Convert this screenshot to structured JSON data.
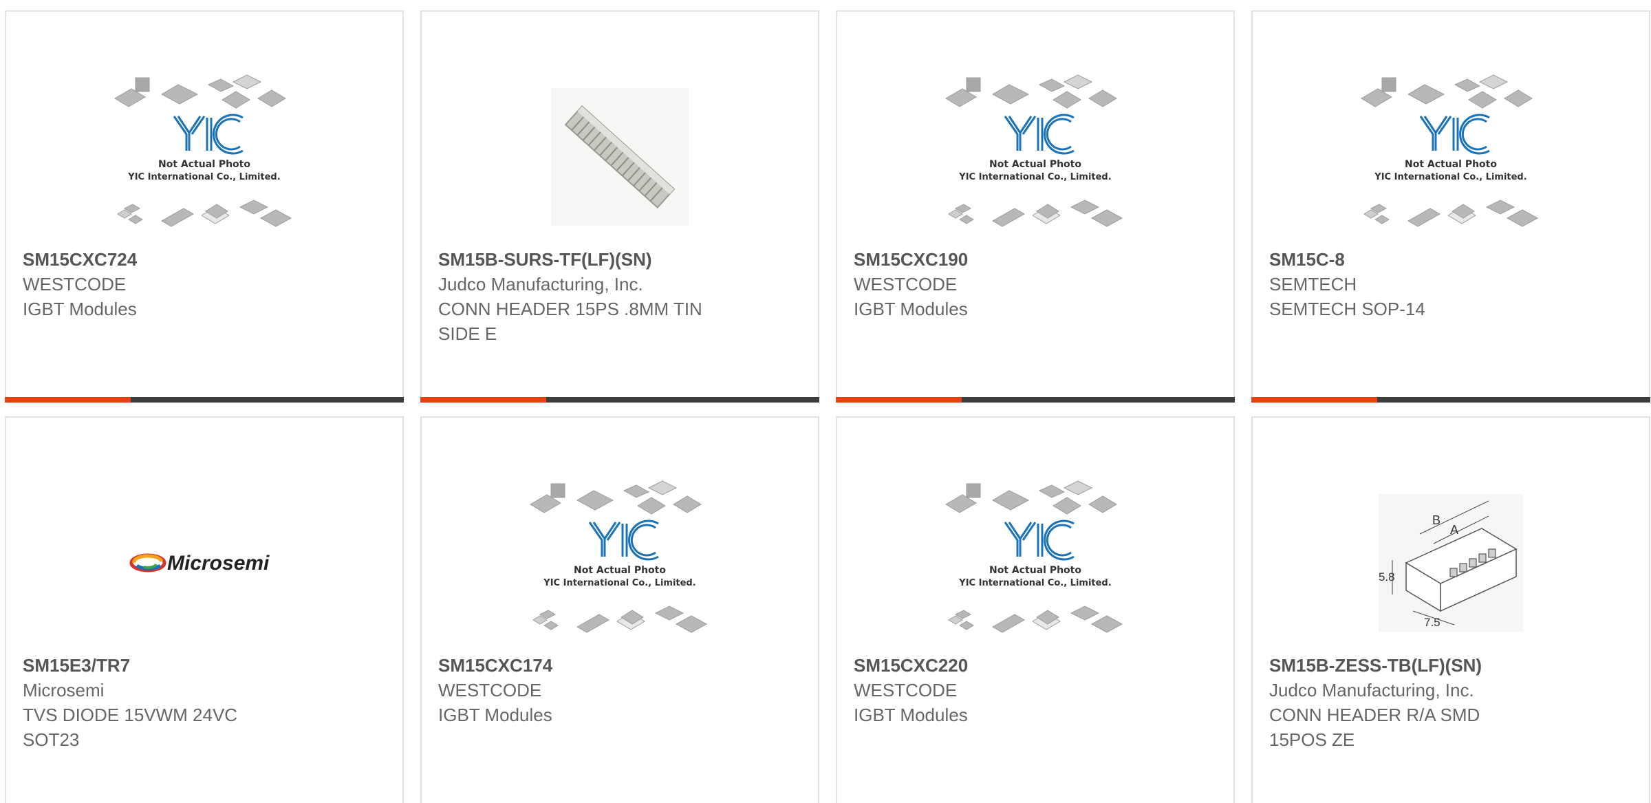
{
  "products": [
    {
      "part_number": "SM15CXC724",
      "manufacturer": "WESTCODE",
      "description": "IGBT Modules",
      "description_line2": "",
      "image": "placeholder",
      "placeholder_text_1": "Not Actual Photo",
      "placeholder_text_2": "YIC International Co., Limited.",
      "placeholder_logo": "YIC"
    },
    {
      "part_number": "SM15B-SURS-TF(LF)(SN)",
      "manufacturer": "Judco Manufacturing, Inc.",
      "description": "CONN HEADER 15PS .8MM TIN",
      "description_line2": "SIDE E",
      "image": "connector-strip"
    },
    {
      "part_number": "SM15CXC190",
      "manufacturer": "WESTCODE",
      "description": "IGBT Modules",
      "description_line2": "",
      "image": "placeholder",
      "placeholder_text_1": "Not Actual Photo",
      "placeholder_text_2": "YIC International Co., Limited.",
      "placeholder_logo": "YIC"
    },
    {
      "part_number": "SM15C-8",
      "manufacturer": "SEMTECH",
      "description": "SEMTECH SOP-14",
      "description_line2": "",
      "image": "placeholder",
      "placeholder_text_1": "Not Actual Photo",
      "placeholder_text_2": "YIC International Co., Limited.",
      "placeholder_logo": "YIC"
    },
    {
      "part_number": "SM15E3/TR7",
      "manufacturer": "Microsemi",
      "description": "TVS DIODE 15VWM 24VC",
      "description_line2": "SOT23",
      "image": "microsemi-logo",
      "logo_text": "Microsemi"
    },
    {
      "part_number": "SM15CXC174",
      "manufacturer": "WESTCODE",
      "description": "IGBT Modules",
      "description_line2": "",
      "image": "placeholder",
      "placeholder_text_1": "Not Actual Photo",
      "placeholder_text_2": "YIC International Co., Limited.",
      "placeholder_logo": "YIC"
    },
    {
      "part_number": "SM15CXC220",
      "manufacturer": "WESTCODE",
      "description": "IGBT Modules",
      "description_line2": "",
      "image": "placeholder",
      "placeholder_text_1": "Not Actual Photo",
      "placeholder_text_2": "YIC International Co., Limited.",
      "placeholder_logo": "YIC"
    },
    {
      "part_number": "SM15B-ZESS-TB(LF)(SN)",
      "manufacturer": "Judco Manufacturing, Inc.",
      "description": "CONN HEADER R/A SMD",
      "description_line2": "15POS ZE",
      "image": "connector-drawing",
      "drawing_labels": [
        "B",
        "A",
        "5.8",
        "7.5"
      ]
    }
  ],
  "colors": {
    "accent": "#e8410f",
    "bar": "#3d3d3d",
    "border": "#e3e3e3",
    "text": "#666666",
    "yic_blue": "#1a73b8"
  }
}
